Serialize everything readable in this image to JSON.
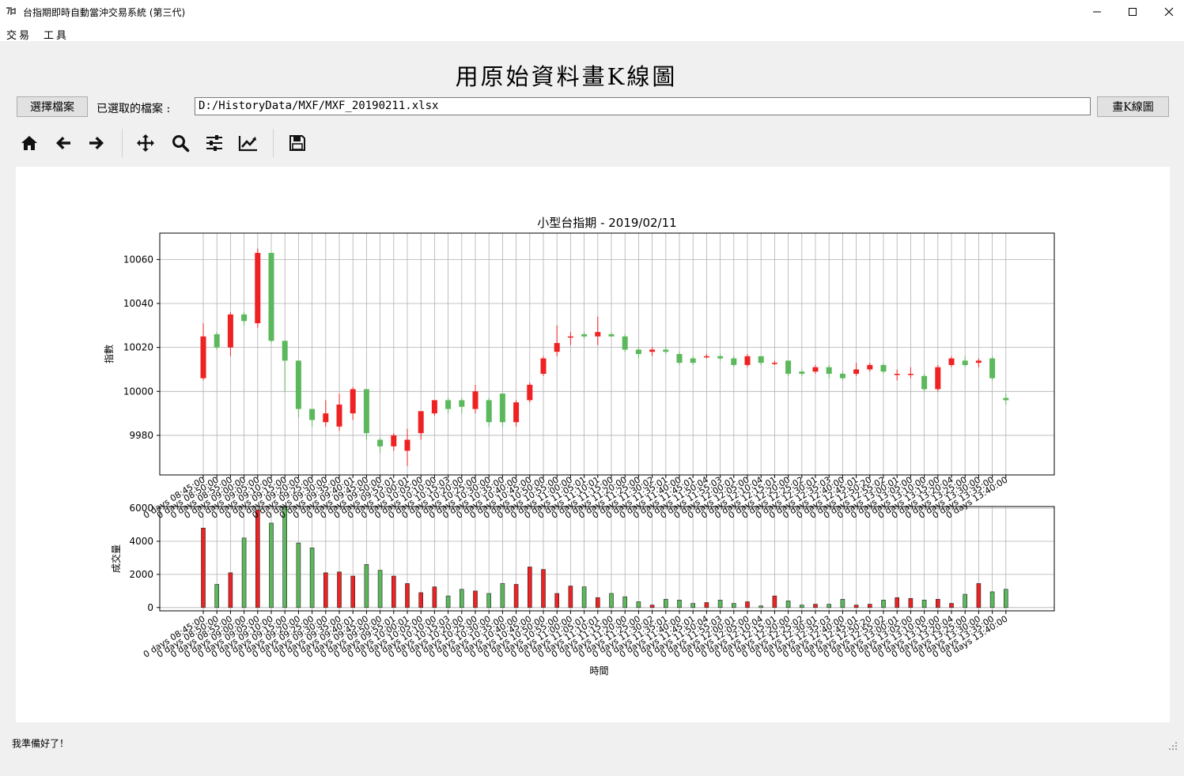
{
  "window": {
    "title": "台指期即時自動當沖交易系統 (第三代)"
  },
  "menu": [
    "交易",
    "工具"
  ],
  "page_title": "用原始資料畫K線圖",
  "file_bar": {
    "choose_label": "選擇檔案",
    "selected_label": "已選取的檔案 :",
    "path": "D:/HistoryData/MXF/MXF_20190211.xlsx",
    "draw_label": "畫K線圖"
  },
  "toolbar": [
    "home-icon",
    "back-icon",
    "forward-icon",
    "pan-icon",
    "zoom-icon",
    "configure-subplots-icon",
    "edit-axis-icon",
    "save-icon"
  ],
  "status": "我準備好了！",
  "colors": {
    "up": "#ee2222",
    "down": "#5cb85c"
  },
  "chart_data": [
    {
      "type": "candlestick",
      "title": "小型台指期 - 2019/02/11",
      "ylabel": "指數",
      "yticks": [
        9980,
        10000,
        10020,
        10040,
        10060
      ],
      "ylim": [
        9962,
        10072
      ],
      "x": [
        "0 days 08:45:00",
        "0 days 08:50:00",
        "0 days 08:55:00",
        "0 days 09:00:00",
        "0 days 09:05:00",
        "0 days 09:10:00",
        "0 days 09:15:00",
        "0 days 09:20:00",
        "0 days 09:25:00",
        "0 days 09:30:00",
        "0 days 09:35:00",
        "0 days 09:40:01",
        "0 days 09:45:00",
        "0 days 09:50:00",
        "0 days 09:55:01",
        "0 days 10:00:01",
        "0 days 10:05:00",
        "0 days 10:10:00",
        "0 days 10:15:03",
        "0 days 10:20:00",
        "0 days 10:25:00",
        "0 days 10:30:00",
        "0 days 10:35:00",
        "0 days 10:40:00",
        "0 days 10:45:00",
        "0 days 10:50:00",
        "0 days 10:55:00",
        "0 days 11:00:00",
        "0 days 11:05:01",
        "0 days 11:10:01",
        "0 days 11:15:00",
        "0 days 11:20:00",
        "0 days 11:25:00",
        "0 days 11:30:02",
        "0 days 11:35:01",
        "0 days 11:40:00",
        "0 days 11:45:01",
        "0 days 11:50:04",
        "0 days 11:55:03",
        "0 days 12:00:01",
        "0 days 12:05:00",
        "0 days 12:10:04",
        "0 days 12:15:01",
        "0 days 12:20:00",
        "0 days 12:25:02",
        "0 days 12:30:01",
        "0 days 12:35:03",
        "0 days 12:40:00",
        "0 days 12:45:01",
        "0 days 12:50:20",
        "0 days 12:55:02",
        "0 days 13:00:01",
        "0 days 13:05:00",
        "0 days 13:10:00",
        "0 days 13:15:00",
        "0 days 13:20:04",
        "0 days 13:25:00",
        "0 days 13:30:00",
        "0 days 13:35:00",
        "0 days 13:40:00"
      ],
      "open": [
        10006,
        10026,
        10020,
        10035,
        10031,
        10063,
        10023,
        10014,
        9992,
        9986,
        9984,
        9990,
        10001,
        9978,
        9975,
        9973,
        9981,
        9990,
        9996,
        9996,
        9992,
        9996,
        9999,
        9986,
        9996,
        10008,
        10018,
        10025,
        10026,
        10025,
        10026,
        10025,
        10019,
        10018,
        10019,
        10017,
        10015,
        10016,
        10016,
        10015,
        10012,
        10016,
        10013,
        10014,
        10009,
        10009,
        10011,
        10008,
        10008,
        10010,
        10012,
        10008,
        10008,
        10007,
        10001,
        10012,
        10014,
        10013,
        10015,
        9997
      ],
      "close": [
        10025,
        10020,
        10035,
        10032,
        10063,
        10023,
        10014,
        9992,
        9987,
        9990,
        9994,
        10001,
        9981,
        9975,
        9980,
        9978,
        9991,
        9996,
        9992,
        9993,
        10000,
        9986,
        9986,
        9995,
        10003,
        10015,
        10022,
        10025,
        10025,
        10027,
        10025,
        10019,
        10017,
        10019,
        10018,
        10013,
        10013,
        10016,
        10015,
        10012,
        10016,
        10013,
        10013,
        10008,
        10008,
        10011,
        10008,
        10006,
        10010,
        10012,
        10009,
        10008,
        10008,
        10001,
        10011,
        10015,
        10012,
        10014,
        10006,
        9996
      ],
      "high": [
        10031,
        10027,
        10036,
        10036,
        10065,
        10063,
        10023,
        10014,
        9992,
        9996,
        9999,
        10002,
        10001,
        9979,
        9981,
        9983,
        9991,
        9996,
        9997,
        9997,
        10003,
        9997,
        9999,
        9996,
        10004,
        10016,
        10030,
        10027,
        10027,
        10034,
        10027,
        10026,
        10020,
        10020,
        10020,
        10018,
        10016,
        10017,
        10017,
        10016,
        10017,
        10016,
        10014,
        10014,
        10010,
        10012,
        10012,
        10009,
        10013,
        10013,
        10013,
        10010,
        10011,
        10008,
        10012,
        10016,
        10016,
        10015,
        10016,
        9999
      ],
      "low": [
        10005,
        10019,
        10016,
        10030,
        10029,
        10022,
        10000,
        9988,
        9984,
        9984,
        9982,
        9987,
        9978,
        9972,
        9973,
        9966,
        9978,
        9989,
        9990,
        9990,
        9990,
        9984,
        9984,
        9984,
        9995,
        10007,
        10016,
        10021,
        10024,
        10021,
        10025,
        10018,
        10015,
        10016,
        10017,
        10012,
        10012,
        10015,
        10014,
        10011,
        10011,
        10012,
        10012,
        10007,
        10007,
        10008,
        10006,
        10005,
        10007,
        10009,
        10008,
        10005,
        10006,
        10000,
        10000,
        10011,
        10011,
        10011,
        10005,
        9994
      ]
    },
    {
      "type": "bar",
      "ylabel": "成交量",
      "xlabel": "時間",
      "yticks": [
        0,
        2000,
        4000,
        6000
      ],
      "ylim": [
        -200,
        6100
      ],
      "values": [
        4800,
        1400,
        2100,
        4200,
        5900,
        5100,
        6050,
        3900,
        3600,
        2100,
        2150,
        1900,
        2600,
        2250,
        1900,
        1450,
        900,
        1250,
        700,
        1100,
        1000,
        850,
        1450,
        1400,
        2450,
        2300,
        850,
        1300,
        1250,
        600,
        850,
        650,
        350,
        150,
        500,
        450,
        250,
        300,
        450,
        250,
        350,
        100,
        700,
        400,
        150,
        200,
        200,
        500,
        150,
        200,
        450,
        600,
        550,
        450,
        500,
        250,
        800,
        1450,
        950,
        1100
      ]
    }
  ]
}
